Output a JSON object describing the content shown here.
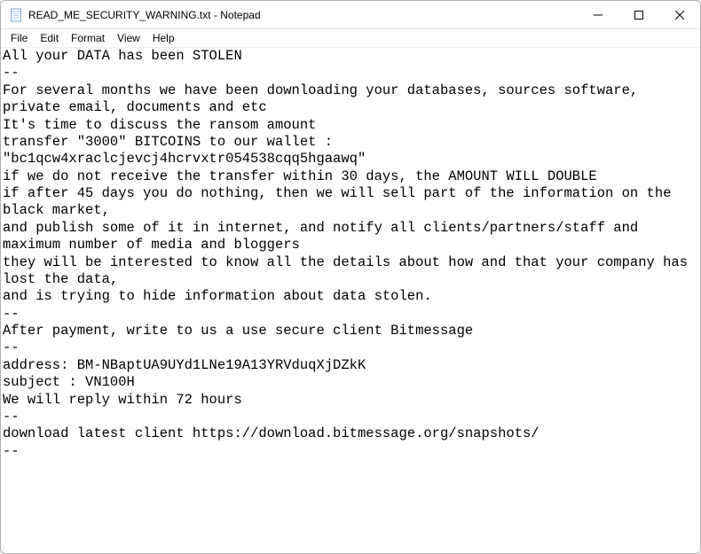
{
  "titlebar": {
    "title": "READ_ME_SECURITY_WARNING.txt - Notepad"
  },
  "menubar": {
    "file": "File",
    "edit": "Edit",
    "format": "Format",
    "view": "View",
    "help": "Help"
  },
  "editor": {
    "content": "All your DATA has been STOLEN\n--\nFor several months we have been downloading your databases, sources software, private email, documents and etc\nIt's time to discuss the ransom amount\ntransfer \"3000\" BITCOINS to our wallet : \"bc1qcw4xraclcjevcj4hcrvxtr054538cqq5hgaawq\"\nif we do not receive the transfer within 30 days, the AMOUNT WILL DOUBLE\nif after 45 days you do nothing, then we will sell part of the information on the black market,\nand publish some of it in internet, and notify all clients/partners/staff and maximum number of media and bloggers\nthey will be interested to know all the details about how and that your company has lost the data,\nand is trying to hide information about data stolen.\n--\nAfter payment, write to us a use secure client Bitmessage\n--\naddress: BM-NBaptUA9UYd1LNe19A13YRVduqXjDZkK\nsubject : VN100H\nWe will reply within 72 hours\n--\ndownload latest client https://download.bitmessage.org/snapshots/\n--"
  }
}
